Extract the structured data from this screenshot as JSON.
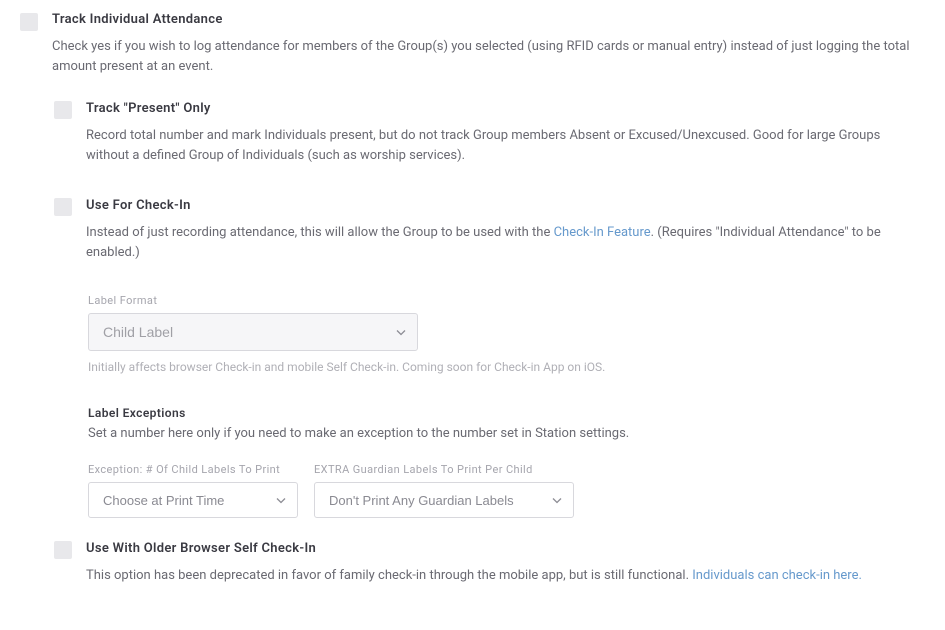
{
  "track_individual": {
    "title": "Track Individual Attendance",
    "desc": "Check yes if you wish to log attendance for members of the Group(s) you selected (using RFID cards or manual entry) instead of just logging the total amount present at an event."
  },
  "track_present": {
    "title": "Track \"Present\" Only",
    "desc": "Record total number and mark Individuals present, but do not track Group members Absent or Excused/Unexcused. Good for large Groups without a defined Group of Individuals (such as worship services)."
  },
  "use_checkin": {
    "title": "Use For Check-In",
    "desc_pre": "Instead of just recording attendance, this will allow the Group to be used with the ",
    "link": "Check-In Feature",
    "desc_post": ". (Requires \"Individual Attendance\" to be enabled.)"
  },
  "label_format": {
    "label": "Label Format",
    "value": "Child Label",
    "note": "Initially affects browser Check-in and mobile Self Check-in. Coming soon for Check-in App on iOS."
  },
  "label_exceptions": {
    "title": "Label Exceptions",
    "desc": "Set a number here only if you need to make an exception to the number set in Station settings.",
    "child_labels": {
      "label": "Exception: # Of Child Labels To Print",
      "value": "Choose at Print Time"
    },
    "guardian_labels": {
      "label": "EXTRA Guardian Labels To Print Per Child",
      "value": "Don't Print Any Guardian Labels"
    }
  },
  "older_browser": {
    "title": "Use With Older Browser Self Check-In",
    "desc_pre": "This option has been deprecated in favor of family check-in through the mobile app, but is still functional. ",
    "link": "Individuals can check-in here."
  }
}
